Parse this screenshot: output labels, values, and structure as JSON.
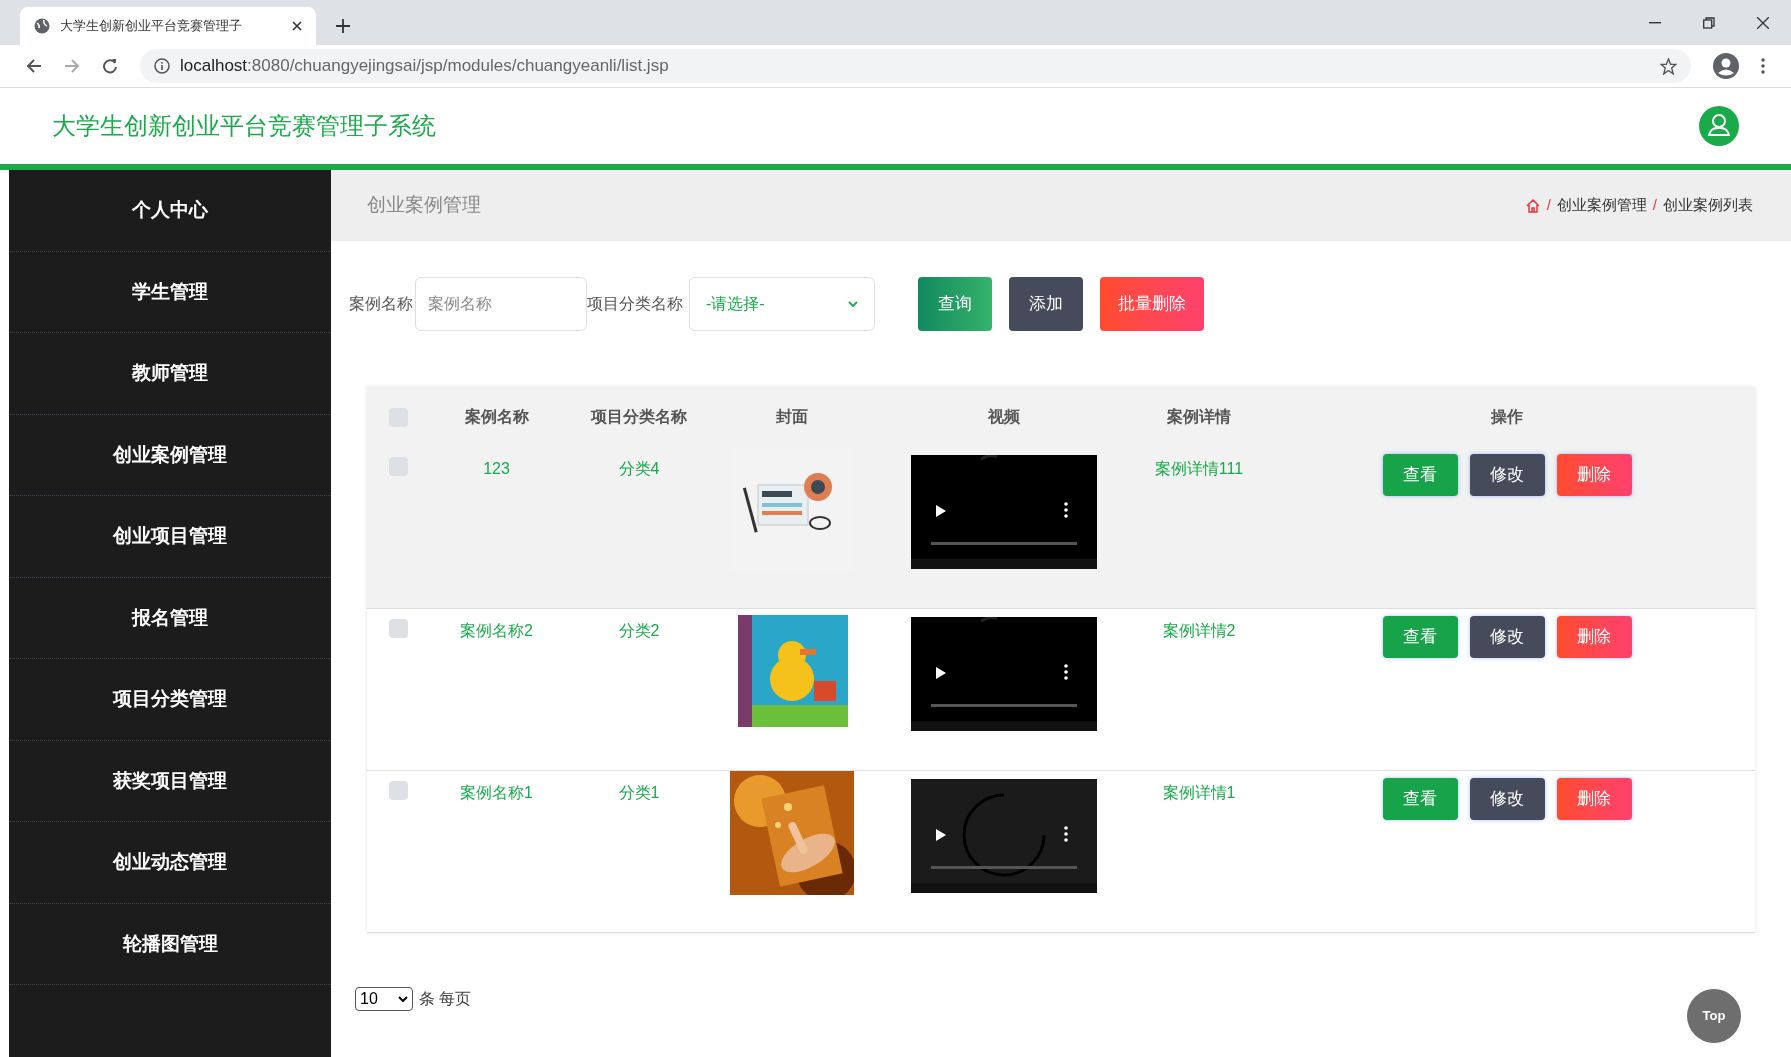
{
  "browser": {
    "tab_title": "大学生创新创业平台竞赛管理子",
    "url_host": "localhost",
    "url_rest": ":8080/chuangyejingsai/jsp/modules/chuangyeanli/list.jsp"
  },
  "header": {
    "title": "大学生创新创业平台竞赛管理子系统"
  },
  "sidebar": {
    "items": [
      {
        "label": "个人中心"
      },
      {
        "label": "学生管理"
      },
      {
        "label": "教师管理"
      },
      {
        "label": "创业案例管理"
      },
      {
        "label": "创业项目管理"
      },
      {
        "label": "报名管理"
      },
      {
        "label": "项目分类管理"
      },
      {
        "label": "获奖项目管理"
      },
      {
        "label": "创业动态管理"
      },
      {
        "label": "轮播图管理"
      }
    ]
  },
  "page": {
    "title": "创业案例管理",
    "breadcrumb": [
      "创业案例管理",
      "创业案例列表"
    ],
    "separator": "/"
  },
  "filters": {
    "fields": [
      {
        "kind": "text",
        "label": "案例名称",
        "placeholder": "案例名称"
      },
      {
        "kind": "select",
        "label": "项目分类名称",
        "value": "-请选择-"
      }
    ],
    "buttons": [
      {
        "kind": "search",
        "label": "查询"
      },
      {
        "kind": "add",
        "label": "添加"
      },
      {
        "kind": "delete",
        "label": "批量删除"
      }
    ]
  },
  "table": {
    "select_all": {
      "checked": false
    },
    "columns": [
      "案例名称",
      "项目分类名称",
      "封面",
      "视频",
      "案例详情",
      "操作"
    ],
    "rows": [
      {
        "checked": false,
        "hovered": true,
        "name": "123",
        "category": "分类4",
        "video": {
          "loading": false
        },
        "detail": "案例详情111",
        "actions": [
          {
            "kind": "view",
            "label": "查看"
          },
          {
            "kind": "edit",
            "label": "修改"
          },
          {
            "kind": "delete",
            "label": "删除"
          }
        ]
      },
      {
        "checked": false,
        "hovered": false,
        "name": "案例名称2",
        "category": "分类2",
        "video": {
          "loading": false
        },
        "detail": "案例详情2",
        "actions": [
          {
            "kind": "view",
            "label": "查看"
          },
          {
            "kind": "edit",
            "label": "修改"
          },
          {
            "kind": "delete",
            "label": "删除"
          }
        ]
      },
      {
        "checked": false,
        "hovered": false,
        "name": "案例名称1",
        "category": "分类1",
        "video": {
          "loading": true
        },
        "detail": "案例详情1",
        "actions": [
          {
            "kind": "view",
            "label": "查看"
          },
          {
            "kind": "edit",
            "label": "修改"
          },
          {
            "kind": "delete",
            "label": "删除"
          }
        ]
      }
    ]
  },
  "pagination": {
    "page_size": "10",
    "suffix": "条 每页"
  },
  "top_button": {
    "label": "Top"
  }
}
